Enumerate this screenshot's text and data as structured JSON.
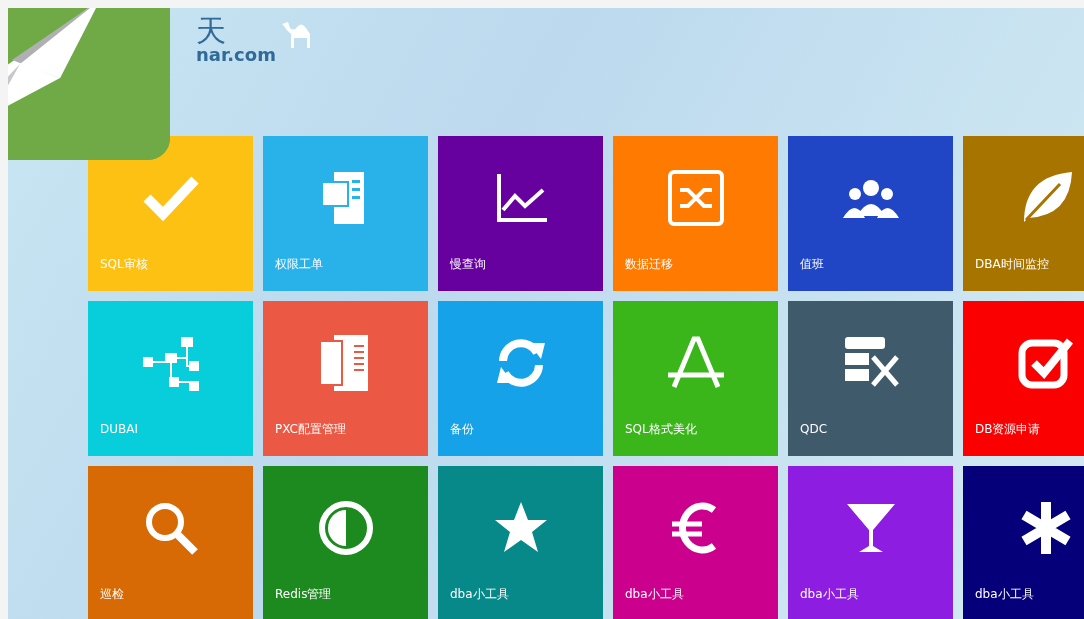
{
  "logo": {
    "mark": "天",
    "domain": "nar.com"
  },
  "tiles": [
    {
      "label": "SQL审核",
      "color": "#fdc114"
    },
    {
      "label": "权限工单",
      "color": "#29b2ea"
    },
    {
      "label": "慢查询",
      "color": "#66009e"
    },
    {
      "label": "数据迁移",
      "color": "#ff7a00"
    },
    {
      "label": "值班",
      "color": "#2046c6"
    },
    {
      "label": "DBA时间监控",
      "color": "#a87400"
    },
    {
      "label": "DUBAI",
      "color": "#08cedc"
    },
    {
      "label": "PXC配置管理",
      "color": "#eb5945"
    },
    {
      "label": "备份",
      "color": "#16a2e8"
    },
    {
      "label": "SQL格式美化",
      "color": "#3ab51a"
    },
    {
      "label": "QDC",
      "color": "#3e5a6b"
    },
    {
      "label": "DB资源申请",
      "color": "#fb0000"
    },
    {
      "label": "巡检",
      "color": "#d86a05"
    },
    {
      "label": "Redis管理",
      "color": "#1c8a1e"
    },
    {
      "label": "dba小工具",
      "color": "#07898a"
    },
    {
      "label": "dba小工具",
      "color": "#cb008c"
    },
    {
      "label": "dba小工具",
      "color": "#8d1de0"
    },
    {
      "label": "dba小工具",
      "color": "#05007a"
    }
  ]
}
